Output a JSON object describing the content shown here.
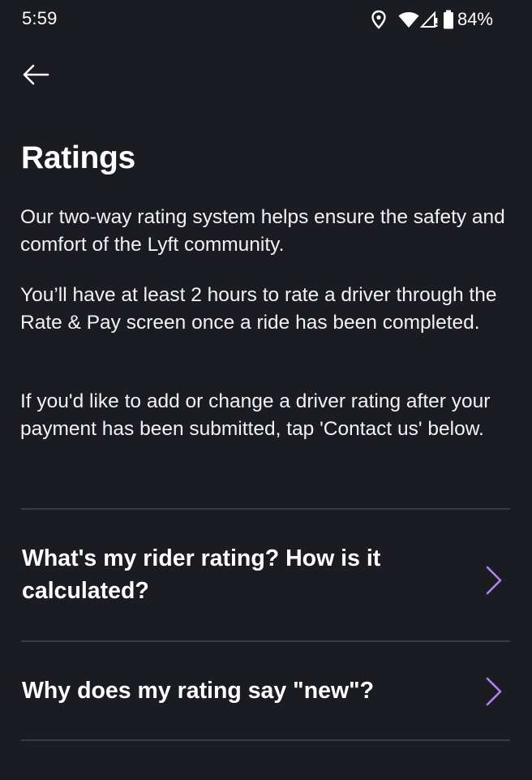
{
  "status_bar": {
    "time": "5:59",
    "battery_percent": "84%",
    "icons": [
      "location-icon",
      "wifi-icon",
      "cell-signal-icon",
      "battery-icon"
    ]
  },
  "header": {
    "back_icon": "arrow-left-icon"
  },
  "page": {
    "title": "Ratings",
    "paragraphs": [
      "Our two-way rating system helps ensure the safety and comfort of the Lyft community.",
      "You’ll have at least 2 hours to rate a driver through the Rate & Pay screen once a ride has been completed.",
      "If you'd like to add or change a driver rating after your payment has been submitted, tap 'Contact us' below."
    ]
  },
  "faq": {
    "items": [
      {
        "label": "What's my rider rating? How is it calculated?",
        "icon": "chevron-right-icon"
      },
      {
        "label": "Why does my rating say \"new\"?",
        "icon": "chevron-right-icon"
      }
    ]
  },
  "colors": {
    "background": "#1b1b22",
    "text": "#ffffff",
    "divider": "#3a3a42",
    "accent": "#b084f0"
  }
}
